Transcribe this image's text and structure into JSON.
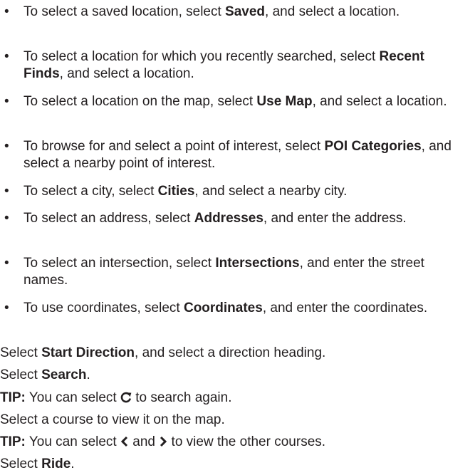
{
  "bullets": [
    {
      "pre": "To select a saved location, select ",
      "bold": "Saved",
      "post": ", and select a location."
    },
    {
      "pre": "To select a location for which you recently searched, select ",
      "bold": "Recent Finds",
      "post": ", and select a location."
    },
    {
      "pre": "To select a location on the map, select ",
      "bold": "Use Map",
      "post": ", and select a location."
    },
    {
      "pre": "To browse for and select a point of interest, select ",
      "bold": "POI Categories",
      "post": ", and select a nearby point of interest."
    },
    {
      "pre": "To select a city, select ",
      "bold": "Cities",
      "post": ", and select a nearby city."
    },
    {
      "pre": "To select an address, select ",
      "bold": "Addresses",
      "post": ", and enter the address."
    },
    {
      "pre": "To select an intersection, select ",
      "bold": "Intersections",
      "post": ", and enter the street names."
    },
    {
      "pre": "To use coordinates, select ",
      "bold": "Coordinates",
      "post": ", and enter the coordinates."
    }
  ],
  "steps": {
    "start_direction": {
      "pre": "Select ",
      "bold": "Start Direction",
      "post": ", and select a direction heading."
    },
    "search": {
      "pre": "Select ",
      "bold": "Search",
      "post": "."
    },
    "tip1": {
      "label": "TIP:",
      "pre": " You can select ",
      "post": " to search again.",
      "icon": "refresh-icon"
    },
    "select_course": {
      "text": "Select a course to view it on the map."
    },
    "tip2": {
      "label": "TIP:",
      "pre": " You can select ",
      "mid": " and ",
      "post": " to view the other courses.",
      "icon_left": "chevron-left-icon",
      "icon_right": "chevron-right-icon"
    },
    "ride": {
      "pre": "Select ",
      "bold": "Ride",
      "post": "."
    }
  },
  "bullet_glyph": "•"
}
